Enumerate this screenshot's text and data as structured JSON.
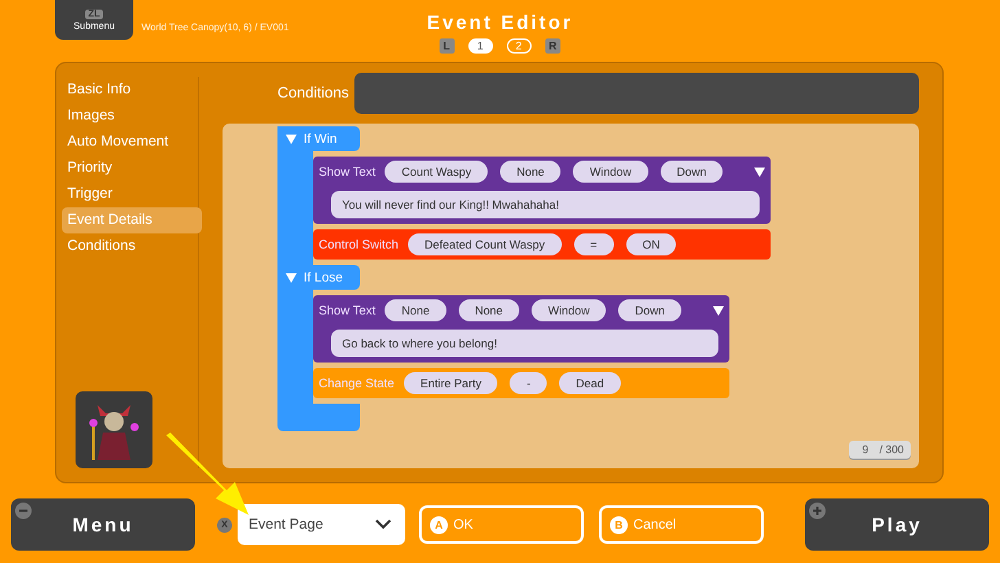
{
  "header": {
    "submenu_key": "ZL",
    "submenu_label": "Submenu",
    "breadcrumb": "World Tree Canopy(10, 6) / EV001",
    "title": "Event Editor",
    "page_left_key": "L",
    "page_right_key": "R",
    "pages": [
      {
        "label": "1",
        "selected": true
      },
      {
        "label": "2",
        "selected": false
      }
    ]
  },
  "sidebar": {
    "items": [
      {
        "label": "Basic Info",
        "selected": false
      },
      {
        "label": "Images",
        "selected": false
      },
      {
        "label": "Auto Movement",
        "selected": false
      },
      {
        "label": "Priority",
        "selected": false
      },
      {
        "label": "Trigger",
        "selected": false
      },
      {
        "label": "Event Details",
        "selected": true
      },
      {
        "label": "Conditions",
        "selected": false
      }
    ]
  },
  "conditions": {
    "label": "Conditions"
  },
  "script": {
    "branches": [
      {
        "label": "If Win",
        "expanded": true,
        "commands": [
          {
            "kind": "show_text",
            "name": "Show Text",
            "params": [
              "Count Waspy",
              "None",
              "Window",
              "Down"
            ],
            "message": "You will never find our King!! Mwahahaha!"
          },
          {
            "kind": "control_switch",
            "name": "Control Switch",
            "params": [
              "Defeated Count Waspy",
              "=",
              "ON"
            ]
          }
        ]
      },
      {
        "label": "If Lose",
        "expanded": true,
        "commands": [
          {
            "kind": "show_text",
            "name": "Show Text",
            "params": [
              "None",
              "None",
              "Window",
              "Down"
            ],
            "message": "Go back to where you belong!"
          },
          {
            "kind": "change_state",
            "name": "Change State",
            "params": [
              "Entire Party",
              "-",
              "Dead"
            ]
          }
        ]
      }
    ],
    "counter": {
      "current": "9",
      "total": "/ 300"
    }
  },
  "footer": {
    "menu_label": "Menu",
    "dropdown_key": "X",
    "dropdown_value": "Event Page",
    "ok_key": "A",
    "ok_label": "OK",
    "cancel_key": "B",
    "cancel_label": "Cancel",
    "play_label": "Play"
  }
}
